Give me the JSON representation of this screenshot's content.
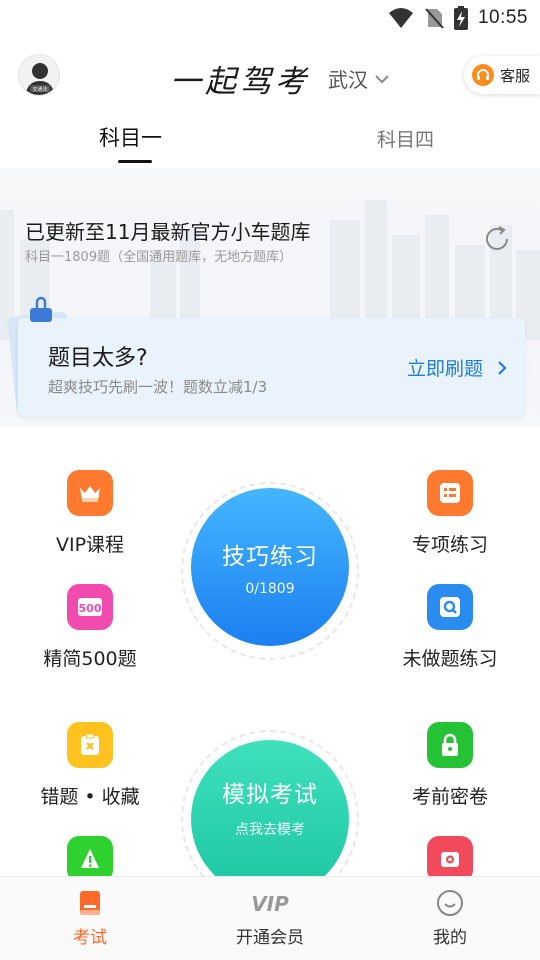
{
  "status_bar": {
    "time": "10:55"
  },
  "header": {
    "app_title": "一起驾考",
    "city": "武汉",
    "service_label": "客服",
    "avatar_badge": "交通法"
  },
  "tabs": [
    {
      "label": "科目一",
      "active": true
    },
    {
      "label": "科目四",
      "active": false
    }
  ],
  "banner": {
    "update_title": "已更新至11月最新官方小车题库",
    "update_sub": "科目一1809题（全国通用题库，无地方题库）",
    "card_title": "题目太多?",
    "card_sub": "超爽技巧先刷一波！题数立减1/3",
    "card_cta": "立即刷题"
  },
  "grid": {
    "left_top": {
      "label": "VIP课程",
      "icon": "crown-icon",
      "color": "#ff7a2e"
    },
    "right_top": {
      "label": "专项练习",
      "icon": "list-icon",
      "color": "#ff7a2e"
    },
    "left_mid": {
      "label": "精简500题",
      "icon": "500-badge-icon",
      "color": "#f24bb0",
      "badge": "500"
    },
    "right_mid": {
      "label": "未做题练习",
      "icon": "search-question-icon",
      "color": "#2b8cf0"
    },
    "left_low": {
      "label": "错题 • 收藏",
      "icon": "wrong-mark-icon",
      "color": "#ffc21f"
    },
    "right_low": {
      "label": "考前密卷",
      "icon": "lock-icon",
      "color": "#25c236"
    },
    "left_bottom": {
      "label": "",
      "icon": "info-icon",
      "color": "#2fd12f"
    },
    "right_bottom": {
      "label": "",
      "icon": "camera-icon",
      "color": "#f14a5c"
    }
  },
  "practice_circle": {
    "title": "技巧练习",
    "progress_text": "0/1809",
    "color_top": "#43b4ff",
    "color_bottom": "#1e82f0"
  },
  "exam_circle": {
    "title": "模拟考试",
    "sub": "点我去模考",
    "color_top": "#3ee0b8",
    "color_bottom": "#1cc7a0"
  },
  "bottom_nav": [
    {
      "label": "考试",
      "icon": "exam-book-icon",
      "active": true,
      "color": "#ff6a2b"
    },
    {
      "label": "开通会员",
      "icon": "vip-icon",
      "active": false
    },
    {
      "label": "我的",
      "icon": "smile-profile-icon",
      "active": false
    }
  ]
}
